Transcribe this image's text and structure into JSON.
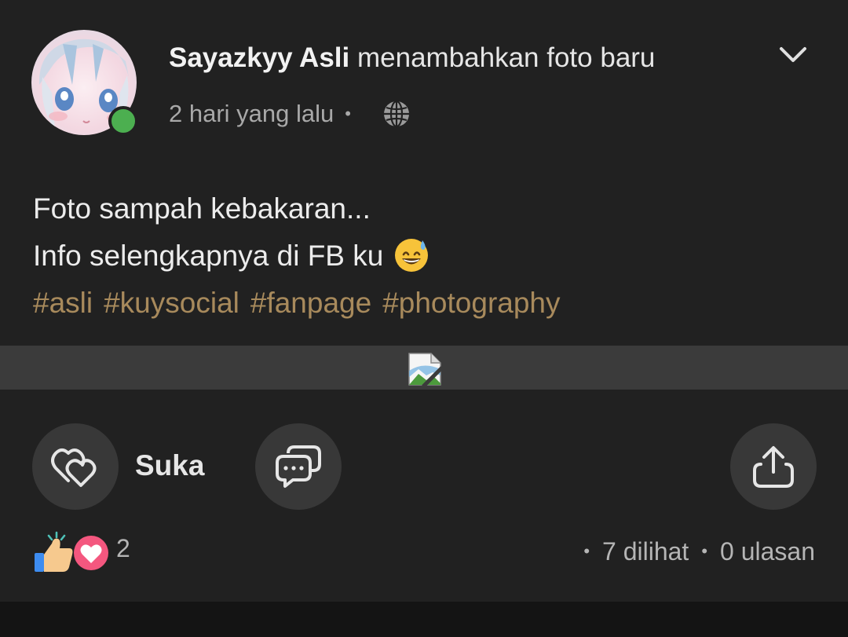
{
  "post": {
    "author_name": "Sayazkyy Asli",
    "action_text": " menambahkan foto baru",
    "timestamp": "2 hari yang lalu",
    "separator": "•",
    "privacy_icon": "globe-icon",
    "menu_icon": "chevron-down-icon",
    "online": true,
    "text_lines": [
      "Foto sampah kebakaran...",
      "Info selengkapnya di FB ku"
    ],
    "emoji": "grinning-sweat-emoji",
    "hashtags": [
      "#asli",
      "#kuysocial",
      "#fanpage",
      "#photography"
    ]
  },
  "media": {
    "state": "broken-image",
    "icon": "broken-image-icon"
  },
  "actions": {
    "like_label": "Suka",
    "like_icon": "heart-outline-icon",
    "comment_icon": "comment-bubbles-icon",
    "share_icon": "share-upload-icon"
  },
  "stats": {
    "reaction_icons": [
      "thumbs-up-icon",
      "heart-icon"
    ],
    "reaction_count": "2",
    "dot": "•",
    "views": "7 dilihat",
    "reviews": "0 ulasan"
  },
  "colors": {
    "background": "#212121",
    "hashtag": "#a88a5c",
    "online_dot": "#4caf50",
    "action_circle": "#383838"
  }
}
